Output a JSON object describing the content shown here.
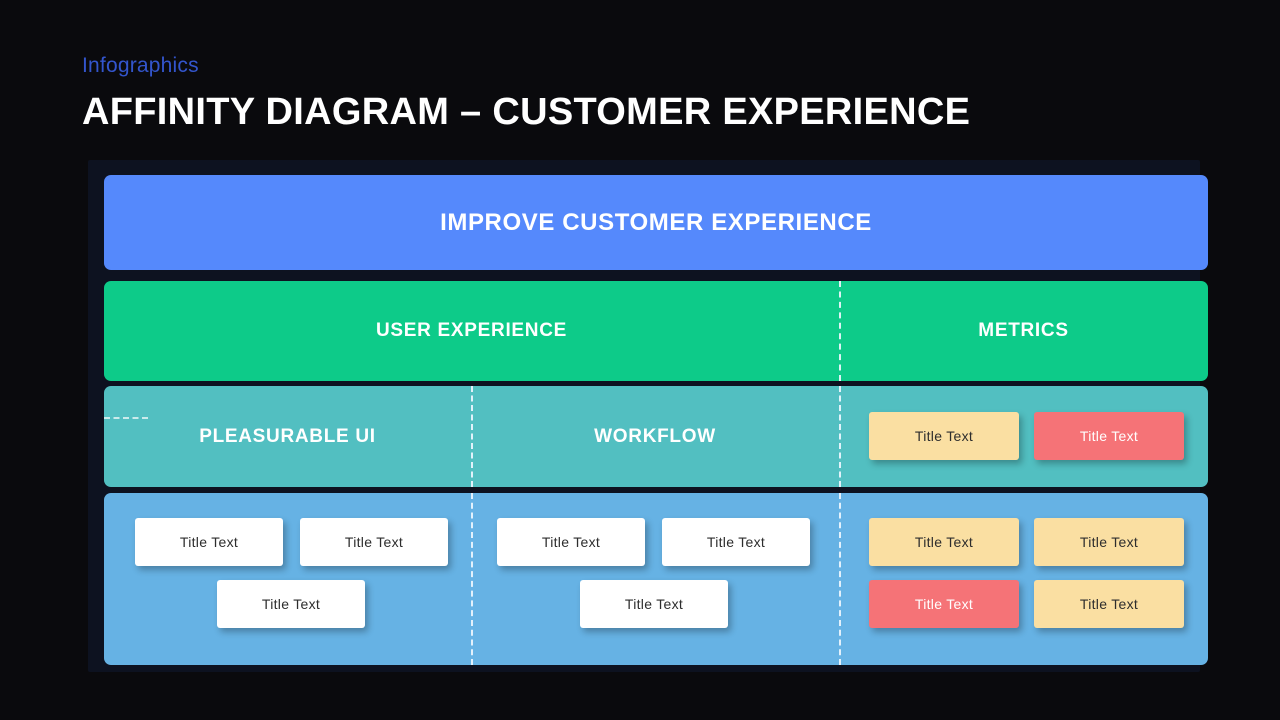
{
  "header": {
    "kicker": "Infographics",
    "title": "AFFINITY DIAGRAM – CUSTOMER EXPERIENCE"
  },
  "colors": {
    "background": "#0a0a0d",
    "panel": "#0d1220",
    "goal_blue": "#5589fc",
    "theme_green": "#0dcb89",
    "subtheme_teal": "#52bfc1",
    "note_band_blue": "#66b2e4",
    "note_white": "#ffffff",
    "note_peach": "#fadfa2",
    "note_salmon": "#f57377",
    "kicker_blue": "#3355cc",
    "divider_white": "#eef7ff"
  },
  "diagram": {
    "goal": {
      "label": "IMPROVE CUSTOMER EXPERIENCE"
    },
    "themes": [
      {
        "label": "USER EXPERIENCE"
      },
      {
        "label": "METRICS"
      }
    ],
    "subthemes": [
      {
        "label": "PLEASURABLE UI"
      },
      {
        "label": "WORKFLOW"
      },
      {
        "label": ""
      }
    ],
    "subtheme_notes": [
      {
        "label": "Title Text",
        "color": "peach"
      },
      {
        "label": "Title Text",
        "color": "salmon"
      }
    ],
    "note_groups": [
      {
        "column": "pleasurable-ui",
        "notes": [
          {
            "label": "Title Text",
            "color": "white"
          },
          {
            "label": "Title Text",
            "color": "white"
          },
          {
            "label": "Title Text",
            "color": "white"
          }
        ]
      },
      {
        "column": "workflow",
        "notes": [
          {
            "label": "Title Text",
            "color": "white"
          },
          {
            "label": "Title Text",
            "color": "white"
          },
          {
            "label": "Title Text",
            "color": "white"
          }
        ]
      },
      {
        "column": "metrics",
        "notes": [
          {
            "label": "Title Text",
            "color": "peach"
          },
          {
            "label": "Title Text",
            "color": "peach"
          },
          {
            "label": "Title Text",
            "color": "salmon"
          },
          {
            "label": "Title Text",
            "color": "peach"
          }
        ]
      }
    ]
  }
}
